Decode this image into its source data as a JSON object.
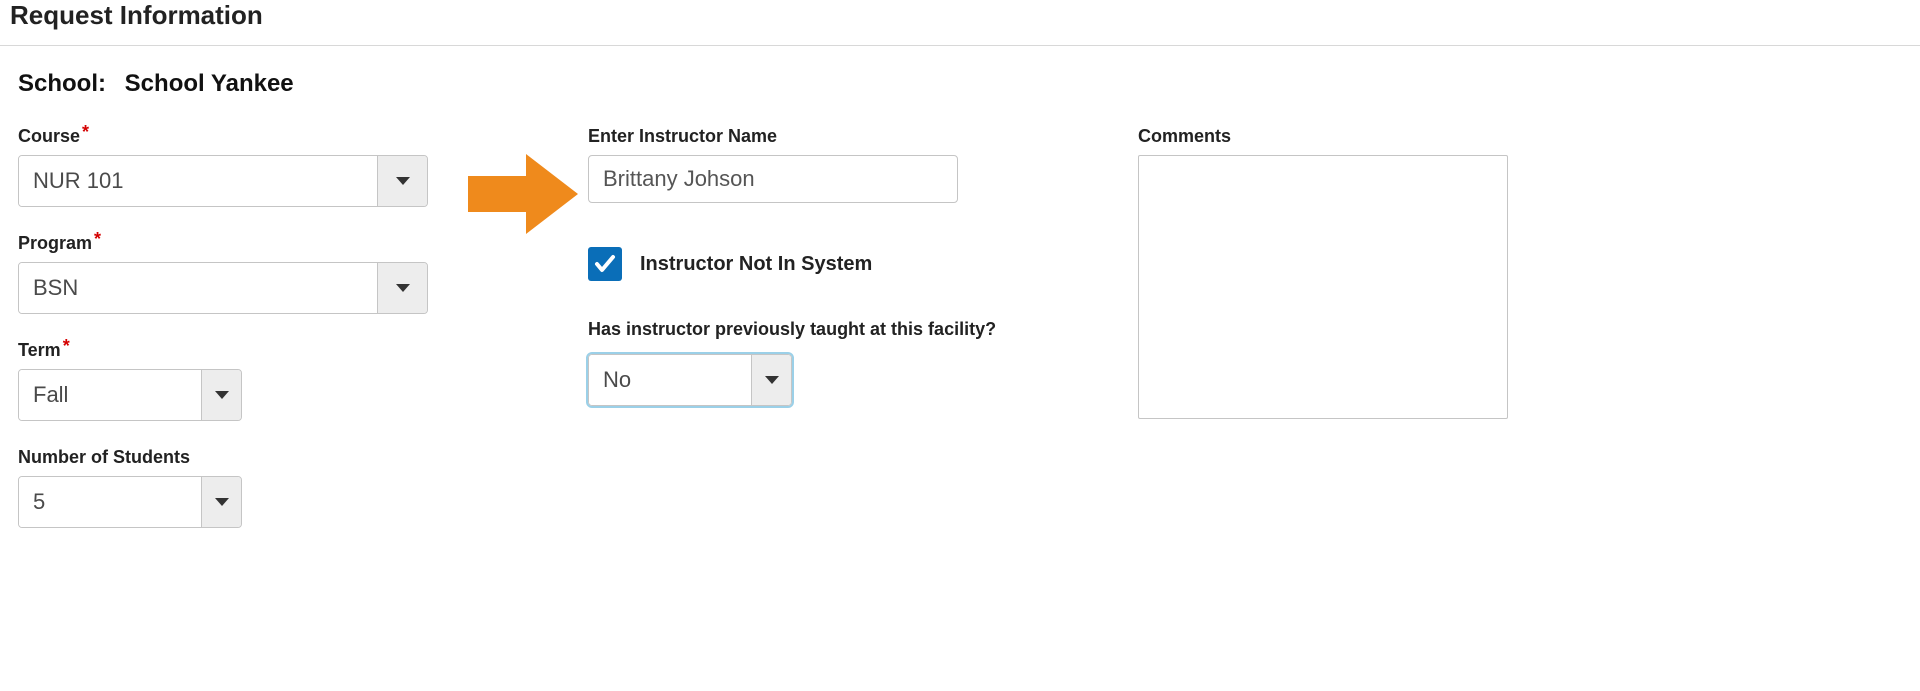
{
  "page": {
    "title": "Request Information"
  },
  "school": {
    "label": "School:",
    "value": "School Yankee"
  },
  "form": {
    "course": {
      "label": "Course",
      "value": "NUR 101",
      "required": true
    },
    "program": {
      "label": "Program",
      "value": "BSN",
      "required": true
    },
    "term": {
      "label": "Term",
      "value": "Fall",
      "required": true
    },
    "num_students": {
      "label": "Number of Students",
      "value": "5",
      "required": false
    },
    "instructor_name": {
      "label": "Enter Instructor Name",
      "value": "Brittany Johson"
    },
    "not_in_system": {
      "label": "Instructor Not In System",
      "checked": true
    },
    "previously_taught": {
      "label": "Has instructor previously taught at this facility?",
      "value": "No"
    },
    "comments": {
      "label": "Comments",
      "value": ""
    }
  },
  "required_marker": "*"
}
